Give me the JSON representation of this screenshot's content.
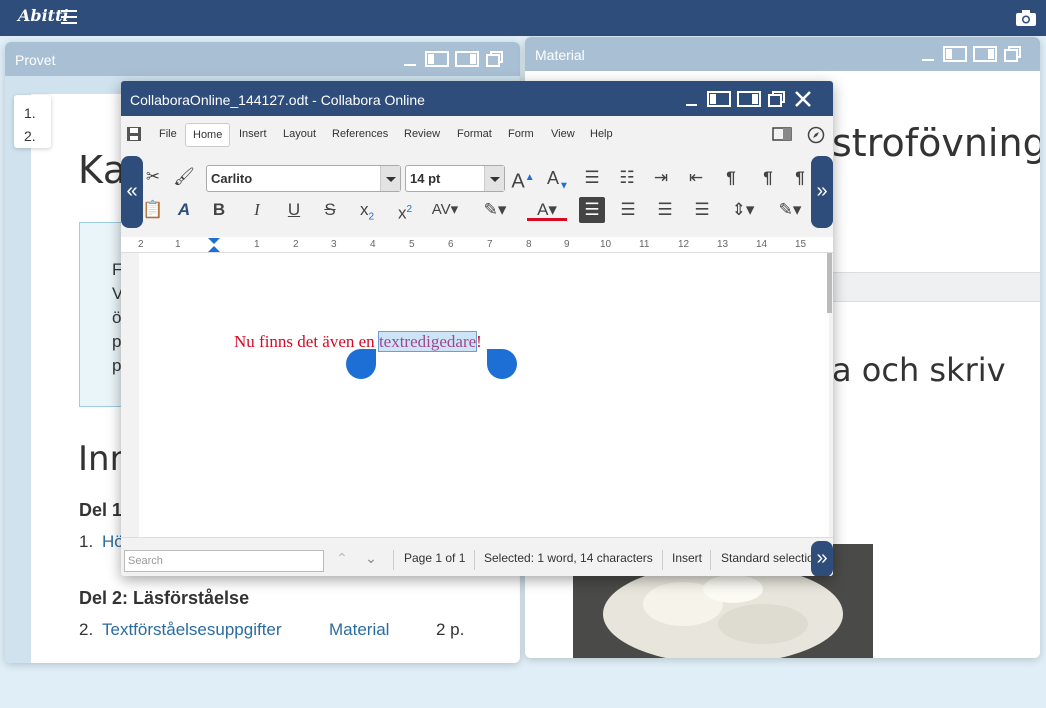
{
  "topbar": {
    "logo": "Abitti",
    "menu_icon": "hamburger-icon",
    "camera_icon": "camera-icon"
  },
  "left_window": {
    "title": "Provet",
    "toc": [
      "1.",
      "2."
    ],
    "heading1": "Kа",
    "box_lines": [
      "F",
      "V",
      "ö",
      "p",
      "p"
    ],
    "heading2": "Inn",
    "section1": "Del 1",
    "row1": {
      "num": "1.",
      "link": "Hö"
    },
    "section2": "Del 2: Läsförståelse",
    "row2": {
      "num": "2.",
      "link": "Textförståelsesuppgifter",
      "material": "Material",
      "points": "2 p."
    }
  },
  "right_window": {
    "title": "Material",
    "heading": "strofövning",
    "subheading": "a och skriv"
  },
  "lo": {
    "title": "CollaboraOnline_144127.odt - Collabora Online",
    "menus": [
      "File",
      "Home",
      "Insert",
      "Layout",
      "References",
      "Review",
      "Format",
      "Form",
      "View",
      "Help"
    ],
    "font_name": "Carlito",
    "font_size": "14 pt",
    "ruler": [
      "2",
      "1",
      "1",
      "2",
      "3",
      "4",
      "5",
      "6",
      "7",
      "8",
      "9",
      "10",
      "11",
      "12",
      "13",
      "14",
      "15"
    ],
    "doc_before": "Nu finns det även en ",
    "doc_sel": "textredigedare",
    "doc_after": "!",
    "search_placeholder": "Search",
    "page_info": "Page 1 of 1",
    "selection_info": "Selected: 1 word, 14 characters",
    "mode": "Insert",
    "selection_mode": "Standard selectio",
    "colors": {
      "accent": "#2e4d7b",
      "text_red": "#d60a24"
    }
  }
}
